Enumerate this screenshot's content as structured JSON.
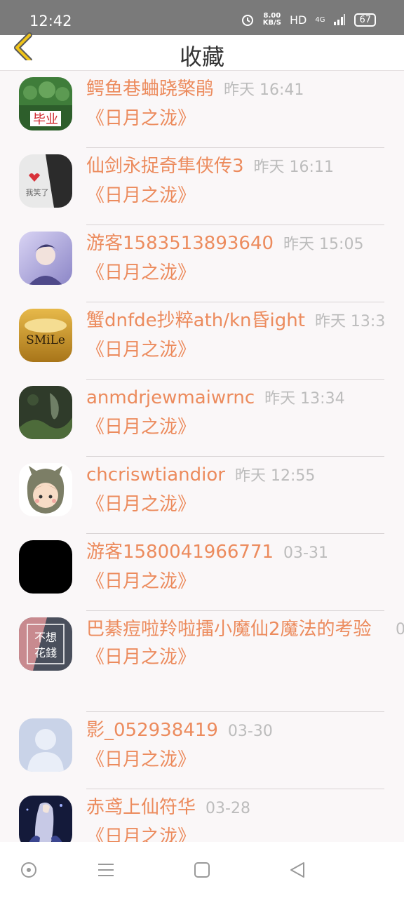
{
  "status_bar": {
    "time": "12:42",
    "speed_value": "8.00",
    "speed_unit": "KB/S",
    "hd": "HD",
    "network": "4G",
    "battery": "67"
  },
  "header": {
    "title": "收藏"
  },
  "items": [
    {
      "name": "鳄鱼巷蛐跷檠鹃",
      "time": "昨天 16:41",
      "book": "《日月之泷》"
    },
    {
      "name": "仙剑永捉奇隼侠传3",
      "time": "昨天 16:11",
      "book": "《日月之泷》"
    },
    {
      "name": "游客1583513893640",
      "time": "昨天 15:05",
      "book": "《日月之泷》"
    },
    {
      "name": "蟹dnfde抄粹ath/kn昏ight",
      "time": "昨天 13:3",
      "book": "《日月之泷》"
    },
    {
      "name": "anmdrjewmaiwrnc",
      "time": "昨天 13:34",
      "book": "《日月之泷》"
    },
    {
      "name": "chcriswtiandior",
      "time": "昨天 12:55",
      "book": "《日月之泷》"
    },
    {
      "name": "游客1580041966771",
      "time": "03-31",
      "book": "《日月之泷》"
    },
    {
      "name": "巴綦痘啦羚啦擂小魔仙2魔法的考验",
      "time": "0",
      "book": "《日月之泷》"
    },
    {
      "name": "影_052938419",
      "time": "03-30",
      "book": "《日月之泷》"
    },
    {
      "name": "赤鸢上仙符华",
      "time": "03-28",
      "book": "《日月之泷》"
    }
  ],
  "avatar_texts": {
    "a1": "毕业",
    "a2": "我笑了",
    "a4": "SMiLe",
    "a8_top": "不想",
    "a8_bottom": "花錢"
  },
  "colors": {
    "accent": "#ec8b5d",
    "time": "#bcbcbc",
    "back_arrow": "#f0c419"
  }
}
